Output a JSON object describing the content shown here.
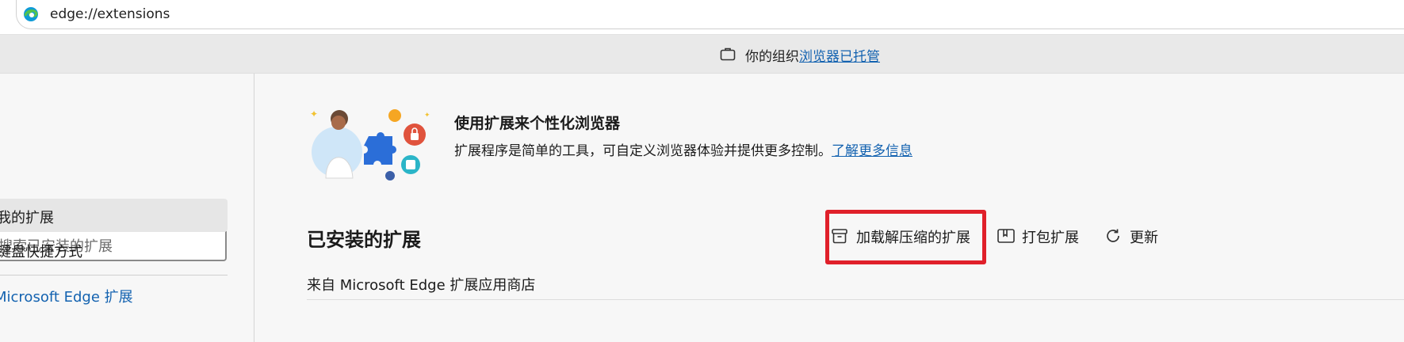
{
  "address_bar": {
    "url": "edge://extensions"
  },
  "managed_notice": {
    "prefix": "你的组织",
    "link": "浏览器已托管"
  },
  "sidebar": {
    "search_placeholder": "搜索已安装的扩展",
    "items": [
      {
        "label": "我的扩展"
      },
      {
        "label": "键盘快捷方式"
      }
    ],
    "store_link": "Microsoft Edge 扩展"
  },
  "hero": {
    "title": "使用扩展来个性化浏览器",
    "description": "扩展程序是简单的工具，可自定义浏览器体验并提供更多控制。",
    "learn_more": "了解更多信息"
  },
  "installed": {
    "title": "已安装的扩展",
    "actions": {
      "load_unpacked": "加载解压缩的扩展",
      "pack": "打包扩展",
      "update": "更新"
    },
    "source_label": "来自 Microsoft Edge 扩展应用商店"
  },
  "colors": {
    "accent_link": "#1362b0",
    "highlight": "#e0202a",
    "sidebar_active": "#e6e6e6"
  }
}
